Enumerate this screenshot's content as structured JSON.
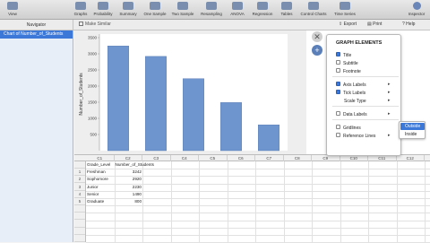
{
  "toolbar": {
    "items": [
      {
        "label": "View",
        "icon": "view-icon"
      },
      {
        "label": "Graphs",
        "icon": "graphs-icon"
      },
      {
        "label": "Probability",
        "icon": "probability-icon"
      },
      {
        "label": "Summary",
        "icon": "summary-icon"
      },
      {
        "label": "One Sample",
        "icon": "one-sample-icon"
      },
      {
        "label": "Two Sample",
        "icon": "two-sample-icon"
      },
      {
        "label": "Resampling",
        "icon": "resampling-icon"
      },
      {
        "label": "ANOVA",
        "icon": "anova-icon"
      },
      {
        "label": "Regression",
        "icon": "regression-icon"
      },
      {
        "label": "Tables",
        "icon": "tables-icon"
      },
      {
        "label": "Control Charts",
        "icon": "control-charts-icon"
      },
      {
        "label": "Time Series",
        "icon": "time-series-icon"
      },
      {
        "label": "Inspector",
        "icon": "inspector-icon"
      }
    ],
    "make_similar": "Make Similar",
    "export": "Export",
    "print": "Print",
    "help": "Help"
  },
  "navigator": {
    "title": "Navigator",
    "items": [
      {
        "label": "Chart of Number_of_Students"
      }
    ]
  },
  "chart_data": {
    "type": "bar",
    "categories": [
      "Freshman",
      "Sophomore",
      "Junior",
      "Senior",
      "Graduate"
    ],
    "values": [
      3242,
      2920,
      2230,
      1490,
      800
    ],
    "title": "",
    "xlabel": "",
    "ylabel": "Number_of_Students",
    "ylim": [
      0,
      3500
    ],
    "yticks": [
      500,
      1000,
      1500,
      2000,
      2500,
      3000,
      3500
    ],
    "bar_color": "#6f95cf",
    "grid": false
  },
  "graph_elements": {
    "title": "GRAPH ELEMENTS",
    "options": [
      {
        "label": "Title",
        "checked": true,
        "submenu": false
      },
      {
        "label": "Subtitle",
        "checked": false,
        "submenu": false
      },
      {
        "label": "Footnote",
        "checked": false,
        "submenu": false
      },
      {
        "label": "Axis Labels",
        "checked": true,
        "submenu": true
      },
      {
        "label": "Tick Labels",
        "checked": true,
        "submenu": true
      },
      {
        "label": "Scale Type",
        "checked": null,
        "submenu": true
      },
      {
        "label": "Data Labels",
        "checked": false,
        "submenu": true
      },
      {
        "label": "Gridlines",
        "checked": false,
        "submenu": false
      },
      {
        "label": "Reference Lines",
        "checked": false,
        "submenu": true
      }
    ],
    "submenu_items": [
      {
        "label": "Outside",
        "selected": true
      },
      {
        "label": "Inside",
        "selected": false
      }
    ],
    "side_buttons": [
      "close-icon",
      "plus-icon"
    ]
  },
  "sheet": {
    "columns": [
      "C1",
      "C2",
      "C3",
      "C4",
      "C5",
      "C6",
      "C7",
      "C8",
      "C9",
      "C10",
      "C11",
      "C12"
    ],
    "headers": [
      "Grade_Level",
      "Number_of_Students"
    ],
    "rows": [
      {
        "n": "1",
        "grade": "Freshman",
        "students": "3242"
      },
      {
        "n": "2",
        "grade": "Sophomore",
        "students": "2920"
      },
      {
        "n": "3",
        "grade": "Junior",
        "students": "2230"
      },
      {
        "n": "4",
        "grade": "Senior",
        "students": "1490"
      },
      {
        "n": "5",
        "grade": "Graduate",
        "students": "800"
      }
    ]
  },
  "colors": {
    "accent": "#3c78d8",
    "toolbar": "#d8d8d8"
  }
}
